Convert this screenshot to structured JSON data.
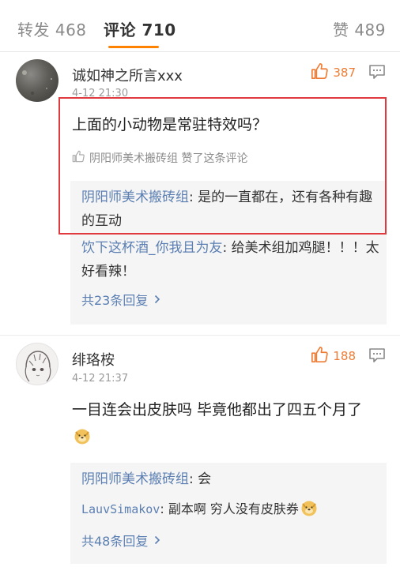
{
  "tabs": {
    "reposts": "转发 468",
    "comments": "评论 710",
    "likes": "赞 489"
  },
  "colors": {
    "accent": "#ff8200",
    "like": "#ee7c34",
    "link": "#5b7fb2",
    "highlight": "#e0393e"
  },
  "comments": [
    {
      "username": "诚如神之所言xxx",
      "time": "4-12 21:30",
      "likes": "387",
      "text": "上面的小动物是常驻特效吗？",
      "liked_by": "阴阳师美术搬砖组 赞了这条评论",
      "replies": [
        {
          "name": "阴阳师美术搬砖组",
          "text": ": 是的一直都在，还有各种有趣的互动"
        },
        {
          "name": "饮下这杯酒_你我且为友",
          "text": ": 给美术组加鸡腿！！！太好看辣！"
        }
      ],
      "more": "共23条回复"
    },
    {
      "username": "绯珞桉",
      "time": "4-12 21:37",
      "likes": "188",
      "text": "一目连会出皮肤吗 毕竟他都出了四五个月了",
      "replies": [
        {
          "name": "阴阳师美术搬砖组",
          "text": ": 会"
        },
        {
          "name": "LauvSimakov",
          "text": ": 副本啊 穷人没有皮肤券"
        }
      ],
      "more": "共48条回复"
    }
  ],
  "icons": {
    "like": "thumbs-up-icon",
    "reply": "comment-bubble-icon",
    "emoji": "doge-emoji-icon",
    "more": "chevron-right-icon"
  }
}
